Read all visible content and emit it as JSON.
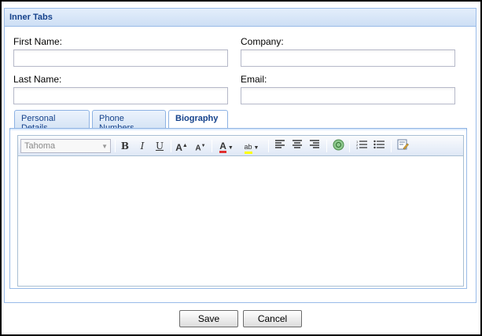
{
  "panel": {
    "title": "Inner Tabs"
  },
  "form": {
    "first_name_label": "First Name:",
    "first_name_value": "",
    "company_label": "Company:",
    "company_value": "",
    "last_name_label": "Last Name:",
    "last_name_value": "",
    "email_label": "Email:",
    "email_value": ""
  },
  "tabs": [
    {
      "label": "Personal Details",
      "active": false
    },
    {
      "label": "Phone Numbers",
      "active": false
    },
    {
      "label": "Biography",
      "active": true
    }
  ],
  "editor": {
    "font_family_value": "Tahoma",
    "toolbar_icons": [
      "bold-icon",
      "italic-icon",
      "underline-icon",
      "grow-font-icon",
      "shrink-font-icon",
      "font-color-icon",
      "highlight-color-icon",
      "align-left-icon",
      "align-center-icon",
      "align-right-icon",
      "insert-link-icon",
      "ordered-list-icon",
      "unordered-list-icon",
      "source-edit-icon"
    ],
    "content": ""
  },
  "buttons": {
    "save_label": "Save",
    "cancel_label": "Cancel"
  },
  "colors": {
    "header_text": "#15428b",
    "border": "#99bbe8",
    "font_color_swatch": "#e03030",
    "highlight_swatch": "#ffff00"
  }
}
